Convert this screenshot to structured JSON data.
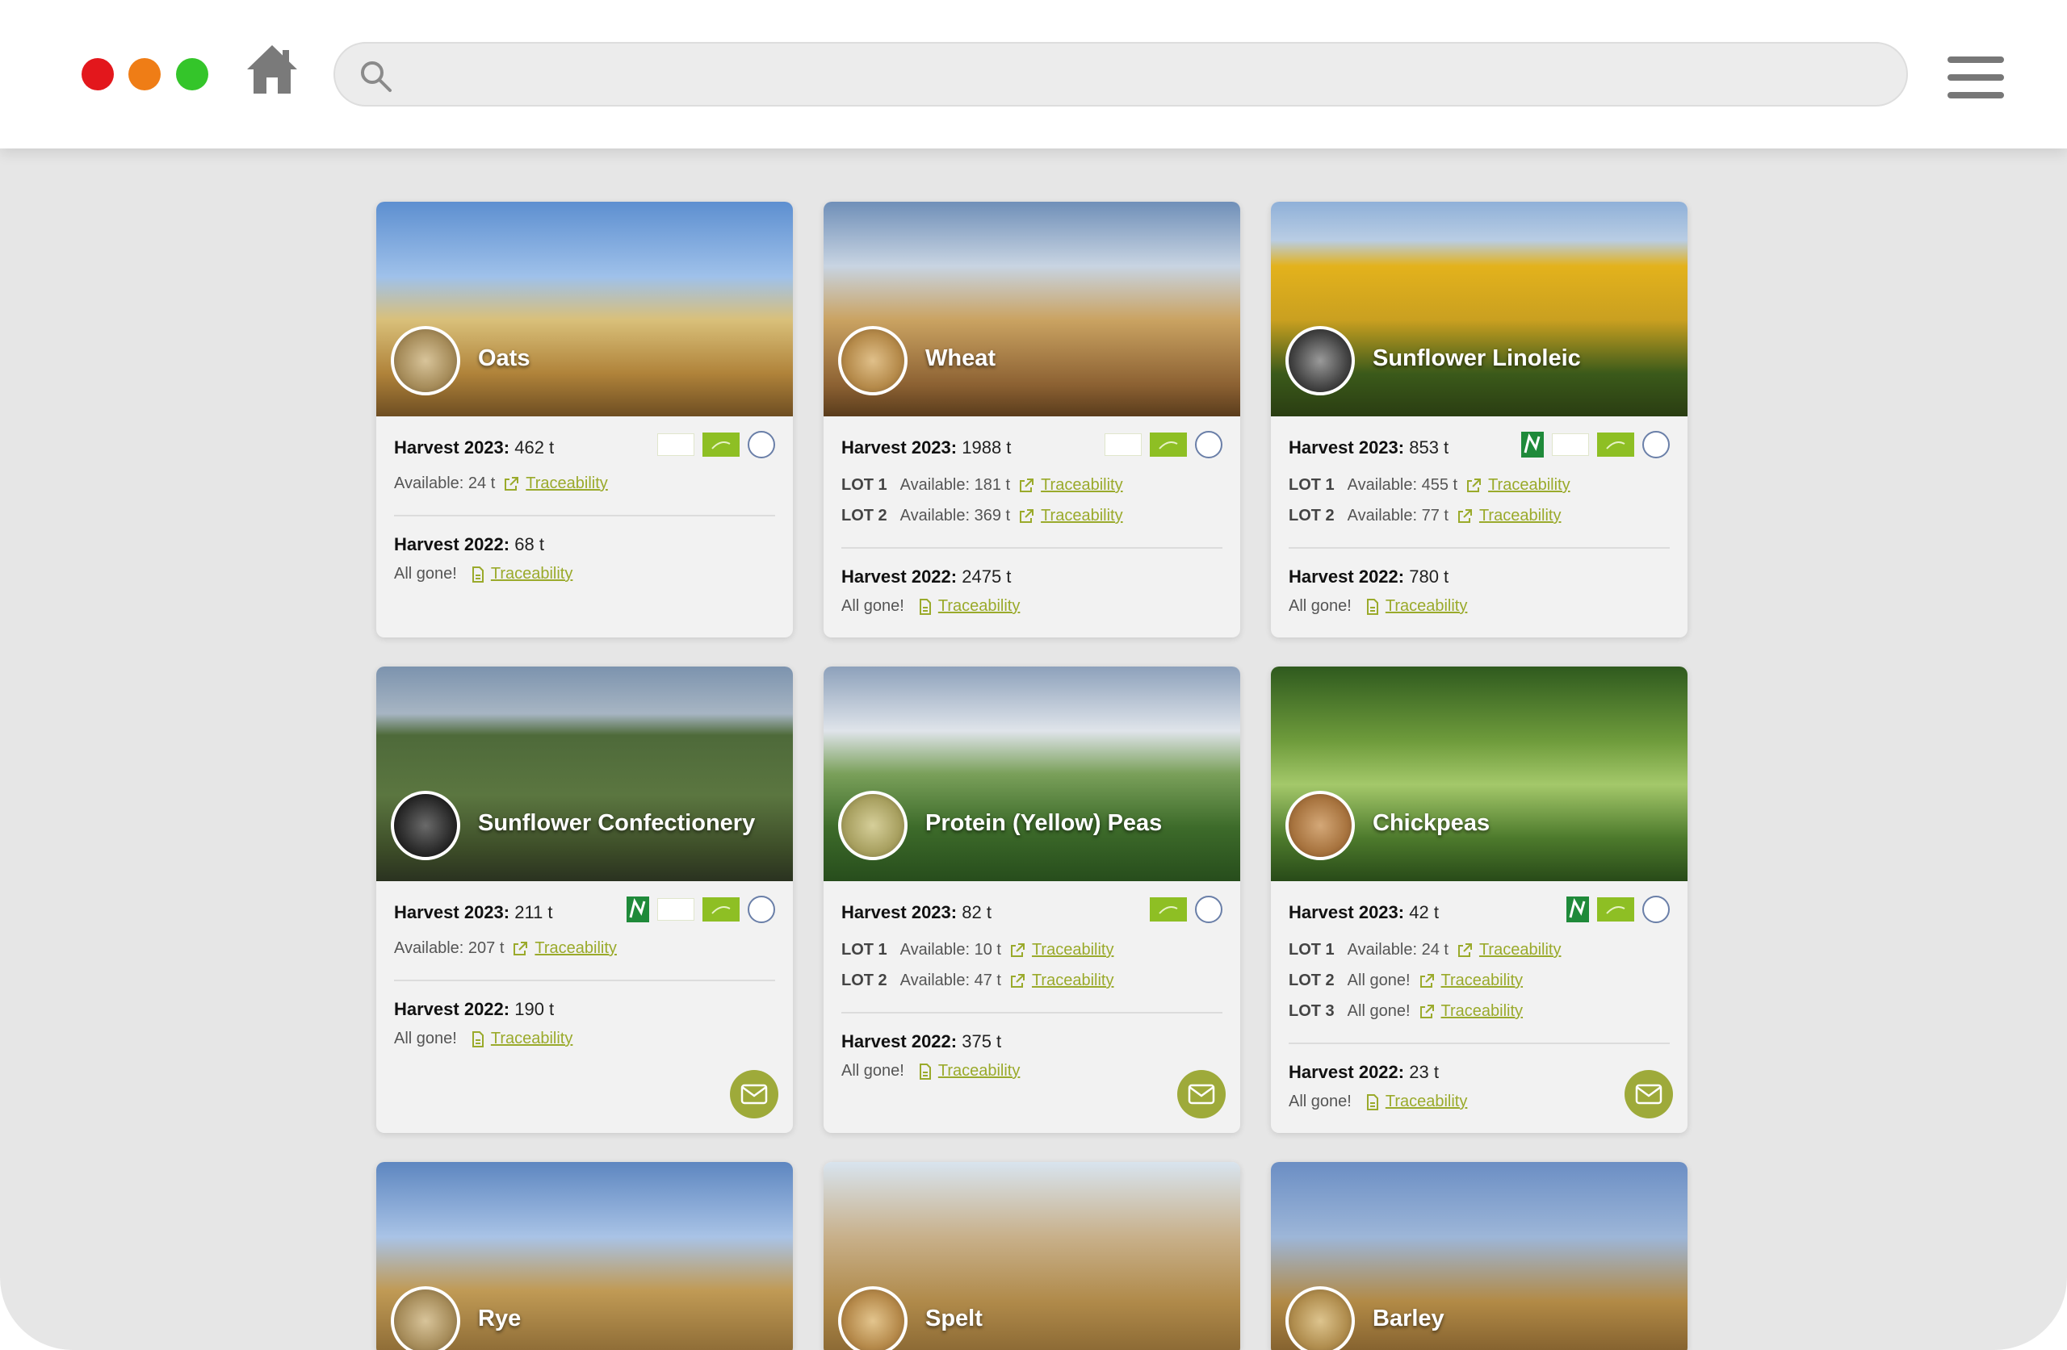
{
  "search": {
    "placeholder": ""
  },
  "colors": {
    "accent": "#9aaa2b",
    "mail_button": "#9eaa3a",
    "eu_badge": "#8ebf24"
  },
  "cards": [
    {
      "name": "Oats",
      "h2023_label": "Harvest 2023:",
      "h2023_value": "462 t",
      "lots": [
        {
          "lot": "",
          "availability": "Available: 24 t",
          "trace": "Traceability"
        }
      ],
      "h2022_label": "Harvest 2022:",
      "h2022_value": "68 t",
      "h2022_status": "All gone!",
      "h2022_trace": "Traceability",
      "badges": [
        "bio-organic",
        "eu-organic",
        "round-seal"
      ],
      "mail": false
    },
    {
      "name": "Wheat",
      "h2023_label": "Harvest 2023:",
      "h2023_value": "1988 t",
      "lots": [
        {
          "lot": "LOT 1",
          "availability": "Available: 181 t",
          "trace": "Traceability"
        },
        {
          "lot": "LOT 2",
          "availability": "Available: 369 t",
          "trace": "Traceability"
        }
      ],
      "h2022_label": "Harvest 2022:",
      "h2022_value": "2475 t",
      "h2022_status": "All gone!",
      "h2022_trace": "Traceability",
      "badges": [
        "bio-organic",
        "eu-organic",
        "round-seal"
      ],
      "mail": false
    },
    {
      "name": "Sunflower Linoleic",
      "h2023_label": "Harvest 2023:",
      "h2023_value": "853 t",
      "lots": [
        {
          "lot": "LOT 1",
          "availability": "Available: 455 t",
          "trace": "Traceability"
        },
        {
          "lot": "LOT 2",
          "availability": "Available: 77 t",
          "trace": "Traceability"
        }
      ],
      "h2022_label": "Harvest 2022:",
      "h2022_value": "780 t",
      "h2022_status": "All gone!",
      "h2022_trace": "Traceability",
      "badges": [
        "naturland",
        "bio-organic",
        "eu-organic",
        "round-seal"
      ],
      "mail": false
    },
    {
      "name": "Sunflower Confectionery",
      "h2023_label": "Harvest 2023:",
      "h2023_value": "211 t",
      "lots": [
        {
          "lot": "",
          "availability": "Available: 207 t",
          "trace": "Traceability"
        }
      ],
      "h2022_label": "Harvest 2022:",
      "h2022_value": "190 t",
      "h2022_status": "All gone!",
      "h2022_trace": "Traceability",
      "badges": [
        "naturland",
        "bio-organic",
        "eu-organic",
        "round-seal"
      ],
      "mail": true
    },
    {
      "name": "Protein (Yellow) Peas",
      "h2023_label": "Harvest 2023:",
      "h2023_value": "82 t",
      "lots": [
        {
          "lot": "LOT 1",
          "availability": "Available: 10 t",
          "trace": "Traceability"
        },
        {
          "lot": "LOT 2",
          "availability": "Available: 47 t",
          "trace": "Traceability"
        }
      ],
      "h2022_label": "Harvest 2022:",
      "h2022_value": "375 t",
      "h2022_status": "All gone!",
      "h2022_trace": "Traceability",
      "badges": [
        "eu-organic",
        "round-seal"
      ],
      "mail": true
    },
    {
      "name": "Chickpeas",
      "h2023_label": "Harvest 2023:",
      "h2023_value": "42 t",
      "lots": [
        {
          "lot": "LOT 1",
          "availability": "Available: 24 t",
          "trace": "Traceability"
        },
        {
          "lot": "LOT 2",
          "availability": "All gone!",
          "trace": "Traceability"
        },
        {
          "lot": "LOT 3",
          "availability": "All gone!",
          "trace": "Traceability"
        }
      ],
      "h2022_label": "Harvest 2022:",
      "h2022_value": "23 t",
      "h2022_status": "All gone!",
      "h2022_trace": "Traceability",
      "badges": [
        "naturland",
        "eu-organic",
        "round-seal"
      ],
      "mail": true
    },
    {
      "name": "Rye"
    },
    {
      "name": "Spelt"
    },
    {
      "name": "Barley"
    }
  ]
}
